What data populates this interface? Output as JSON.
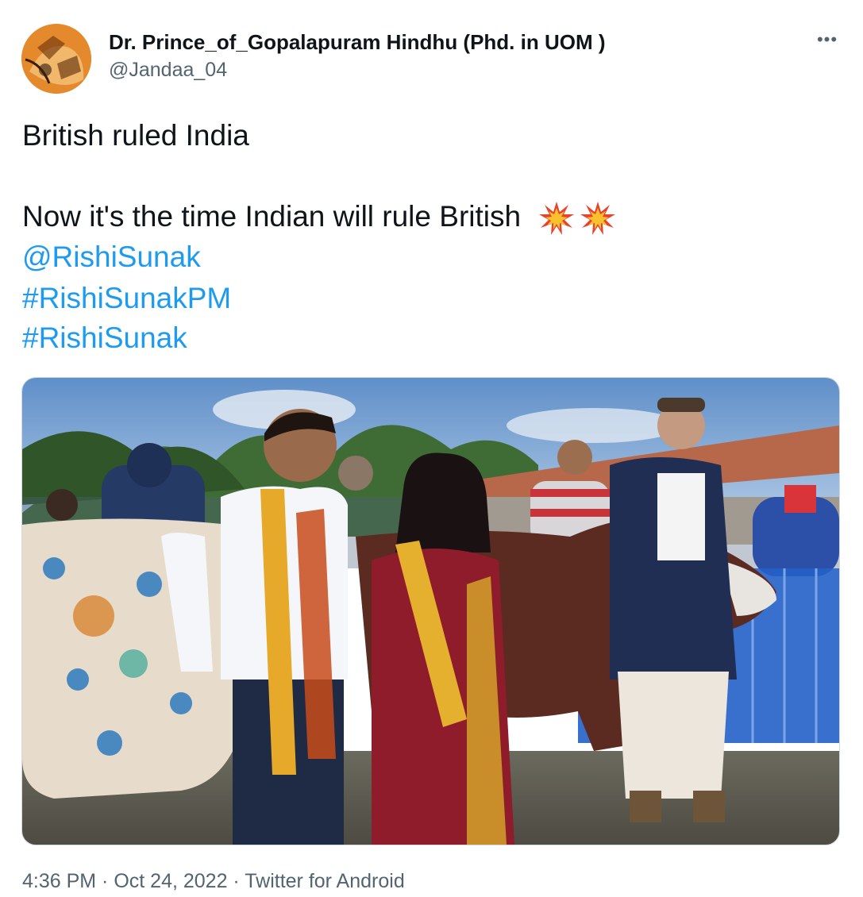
{
  "tweet": {
    "author_name": "Dr. Prince_of_Gopalapuram Hindhu (Phd. in UOM )",
    "author_handle": "@Jandaa_04",
    "more_label": "•••",
    "text_line1": "British ruled India",
    "text_line2": "Now it's the time  Indian will rule British",
    "emojis": [
      "collision-emoji",
      "collision-emoji"
    ],
    "mention": "@RishiSunak",
    "hashtags": [
      "#RishiSunakPM",
      "#RishiSunak"
    ],
    "time": "4:36 PM",
    "date": "Oct 24, 2022",
    "source": "Twitter for Android",
    "separator": " · "
  },
  "colors": {
    "link": "#1d9bf0",
    "secondary_text": "#536471",
    "primary_text": "#0f1419"
  }
}
